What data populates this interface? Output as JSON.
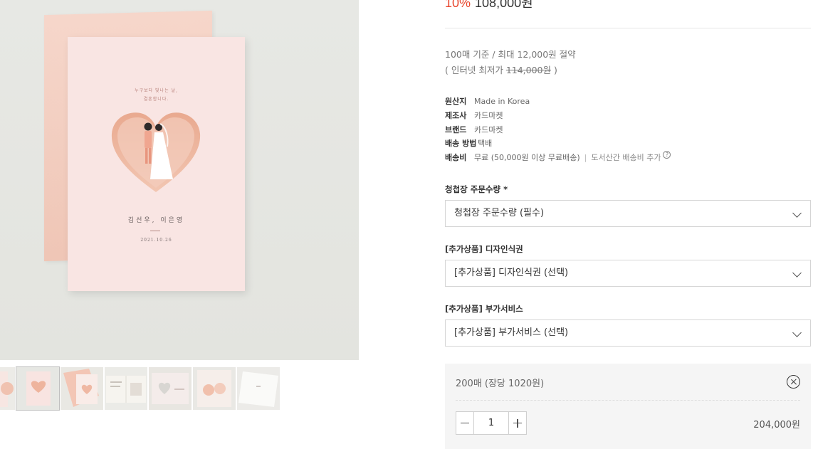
{
  "product": {
    "discount": "10%",
    "price": "108,000원"
  },
  "bulk_info": {
    "line1": "100매 기준 / 최대 12,000원 절약",
    "line2_prefix": "( 인터넷 최저가 ",
    "line2_strike": "114,000원",
    "line2_suffix": " )"
  },
  "specs": [
    {
      "label": "원산지",
      "value": "Made in Korea"
    },
    {
      "label": "제조사",
      "value": "카드마켓"
    },
    {
      "label": "브랜드",
      "value": "카드마켓"
    },
    {
      "label": "배송 방법",
      "value": "택배"
    },
    {
      "label": "배송비",
      "value": "무료 (50,000원 이상 무료배송)",
      "extra": "도서산간 배송비 추가"
    }
  ],
  "options": [
    {
      "label": "청첩장 주문수량",
      "required_mark": " *",
      "placeholder": "청첩장 주문수량 (필수)"
    },
    {
      "label": "[추가상품] 디자인식권",
      "required_mark": "",
      "placeholder": "[추가상품] 디자인식권 (선택)"
    },
    {
      "label": "[추가상품] 부가서비스",
      "required_mark": "",
      "placeholder": "[추가상품] 부가서비스 (선택)"
    }
  ],
  "selected_item": {
    "name": "200매 (장당 1020원)",
    "quantity": "1",
    "total": "204,000원"
  },
  "card_art": {
    "top_text_1": "누구보다 빛나는 날,",
    "top_text_2": "결혼합니다.",
    "names": "김선우, 이은영",
    "date": "2021.10.26"
  },
  "colors": {
    "discount": "#e8472e",
    "card_pink": "#f9e5e3",
    "envelope_pink": "#f3c7b6"
  }
}
